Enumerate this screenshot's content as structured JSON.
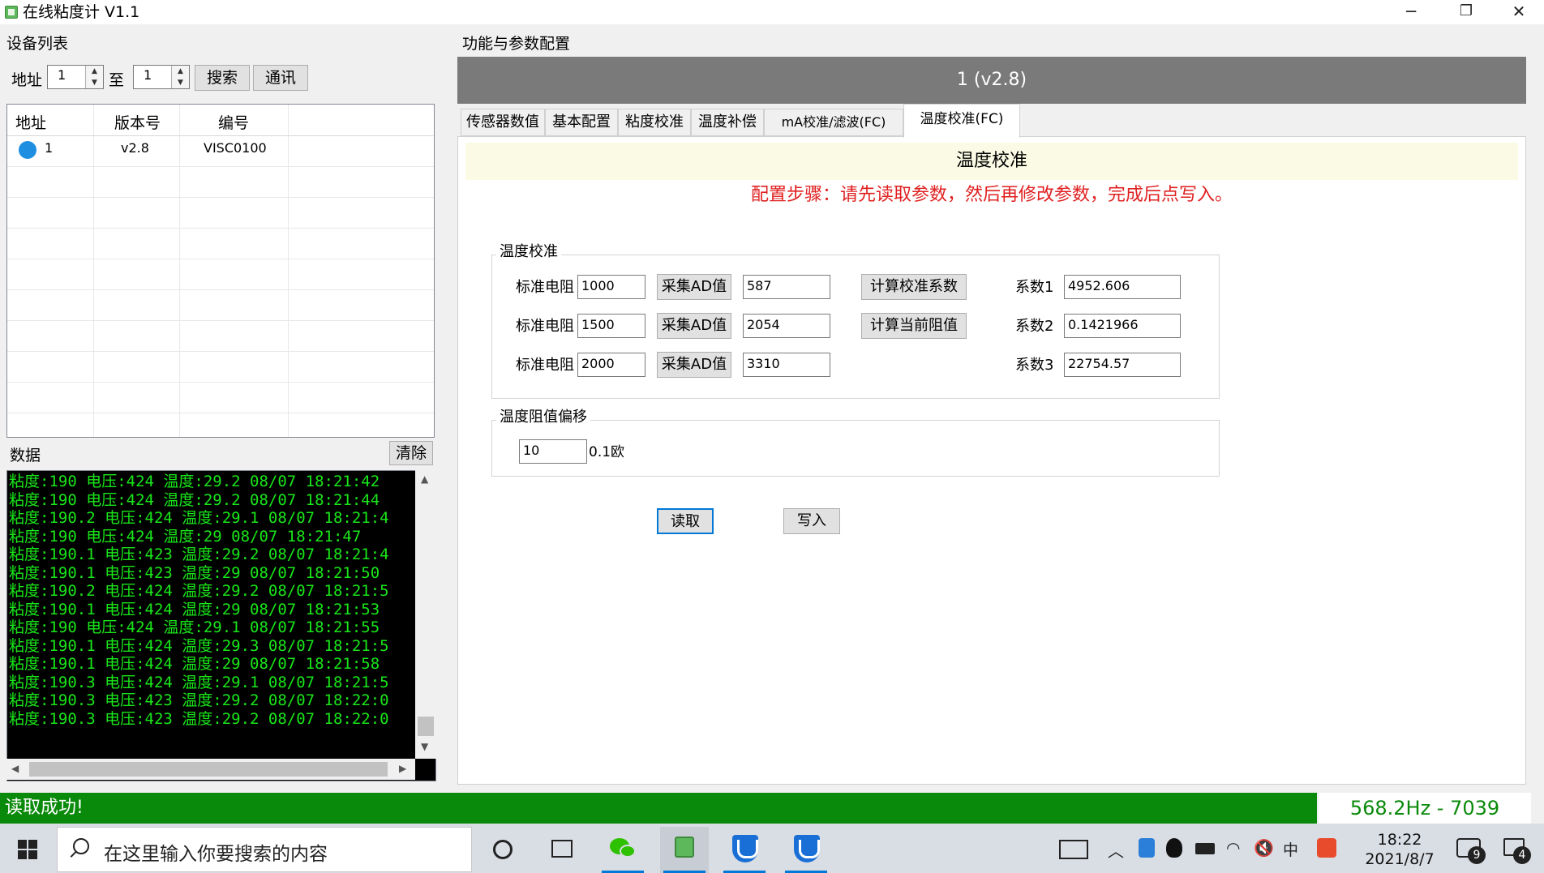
{
  "window": {
    "title": "在线粘度计 V1.1",
    "controls": {
      "minimize": "─",
      "restore": "❐",
      "close": "✕"
    }
  },
  "left": {
    "device_list_label": "设备列表",
    "address_label": "地址",
    "from_value": "1",
    "to_label": "至",
    "to_value": "1",
    "search_button": "搜索",
    "comm_button": "通讯",
    "table": {
      "columns": [
        "地址",
        "版本号",
        "编号"
      ],
      "rows": [
        {
          "address": "1",
          "version": "v2.8",
          "serial": "VISC0100",
          "status_color": "#1e8fe0"
        }
      ]
    },
    "data_label": "数据",
    "clear_button": "清除",
    "log": [
      "粘度:190 电压:424 温度:29.2 08/07 18:21:42",
      "粘度:190 电压:424 温度:29.2 08/07 18:21:44",
      "粘度:190.2 电压:424 温度:29.1 08/07 18:21:4",
      "粘度:190 电压:424 温度:29 08/07 18:21:47",
      "粘度:190.1 电压:423 温度:29.2 08/07 18:21:4",
      "粘度:190.1 电压:423 温度:29 08/07 18:21:50",
      "粘度:190.2 电压:424 温度:29.2 08/07 18:21:5",
      "粘度:190.1 电压:424 温度:29 08/07 18:21:53",
      "粘度:190 电压:424 温度:29.1 08/07 18:21:55",
      "粘度:190.1 电压:424 温度:29.3 08/07 18:21:5",
      "粘度:190.1 电压:424 温度:29 08/07 18:21:58",
      "粘度:190.3 电压:424 温度:29.1 08/07 18:21:5",
      "粘度:190.3 电压:423 温度:29.2 08/07 18:22:0",
      "粘度:190.3 电压:423 温度:29.2 08/07 18:22:0"
    ]
  },
  "right": {
    "section_label": "功能与参数配置",
    "device_header": "1 (v2.8)",
    "tabs": [
      "传感器数值",
      "基本配置",
      "粘度校准",
      "温度补偿",
      "mA校准/滤波(FC)",
      "温度校准(FC)"
    ],
    "active_tab": "温度校准(FC)",
    "panel_title": "温度校准",
    "steps": "配置步骤：请先读取参数，然后再修改参数，完成后点写入。",
    "calib_group": {
      "title": "温度校准",
      "std_label": "标准电阻",
      "collect_button": "采集AD值",
      "std_values": [
        "1000",
        "1500",
        "2000"
      ],
      "ad_values": [
        "587",
        "2054",
        "3310"
      ],
      "calc_coef_button": "计算校准系数",
      "calc_res_button": "计算当前阻值",
      "coef_labels": [
        "系数1",
        "系数2",
        "系数3"
      ],
      "coef_values": [
        "4952.606",
        "0.1421966",
        "22754.57"
      ]
    },
    "offset_group": {
      "title": "温度阻值偏移",
      "value": "10",
      "unit": "0.1欧"
    },
    "read_button": "读取",
    "write_button": "写入"
  },
  "status": {
    "message": "读取成功!",
    "frequency": "568.2Hz - 7039",
    "bar_color": "#0a8a0a"
  },
  "taskbar": {
    "search_placeholder": "在这里输入你要搜索的内容",
    "time": "18:22",
    "date": "2021/8/7",
    "wechat_badge": "9",
    "notification_badge": "4",
    "ime_label": "中"
  }
}
